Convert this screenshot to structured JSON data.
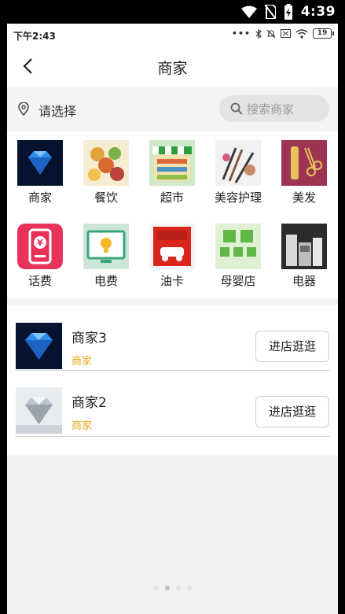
{
  "device_status": {
    "time": "4:39"
  },
  "app_status": {
    "time": "下午2:43",
    "battery": "19"
  },
  "header": {
    "title": "商家"
  },
  "search": {
    "location_label": "请选择",
    "placeholder": "搜索商家"
  },
  "categories": [
    {
      "label": "商家"
    },
    {
      "label": "餐饮"
    },
    {
      "label": "超市"
    },
    {
      "label": "美容护理"
    },
    {
      "label": "美发"
    },
    {
      "label": "话费"
    },
    {
      "label": "电费"
    },
    {
      "label": "油卡"
    },
    {
      "label": "母婴店"
    },
    {
      "label": "电器"
    }
  ],
  "merchants": [
    {
      "name": "商家3",
      "tag": "商家",
      "button": "进店逛逛"
    },
    {
      "name": "商家2",
      "tag": "商家",
      "button": "进店逛逛"
    }
  ],
  "colors": {
    "accent_tag": "#e6a817",
    "bg": "#f2f2f2"
  }
}
